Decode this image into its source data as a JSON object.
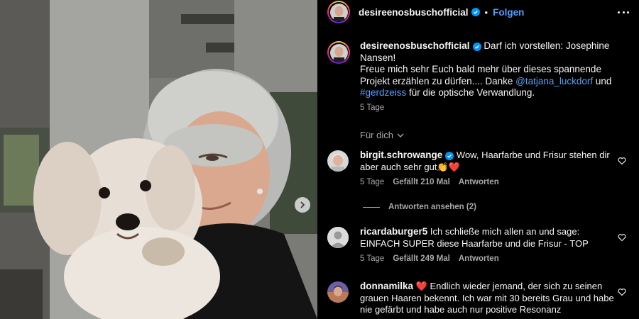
{
  "post": {
    "username": "desireenosbuschofficial",
    "follow_label": "Folgen",
    "separator": "•",
    "more_icon": "more-horizontal-icon",
    "next_icon": "chevron-right-icon"
  },
  "caption": {
    "username": "desireenosbuschofficial",
    "text_1": "Darf ich vorstellen: Josephine Nansen!",
    "text_2": "Freue mich sehr Euch bald mehr über dieses spannende Projekt erzählen zu dürfen.... Danke ",
    "mention": "@tatjana_luckdorf",
    "text_3": " und ",
    "hashtag": "#gerdzeiss",
    "text_4": " für die optische Verwandlung.",
    "time": "5 Tage"
  },
  "for_you": {
    "label": "Für dich"
  },
  "comments": [
    {
      "username": "birgit.schrowange",
      "verified": true,
      "text": "Wow, Haarfarbe und Frisur stehen dir aber auch sehr gut",
      "emoji": "👏❤️",
      "time": "5 Tage",
      "likes": "Gefällt 210 Mal",
      "reply": "Antworten"
    },
    {
      "username": "ricardaburger5",
      "verified": false,
      "text": "Ich schließe mich allen an und sage: EINFACH SUPER diese Haarfarbe und die Frisur - TOP",
      "time": "5 Tage",
      "likes": "Gefällt 249 Mal",
      "reply": "Antworten"
    },
    {
      "username": "donnamilka",
      "verified": false,
      "text": "❤️ Endlich wieder jemand, der sich zu seinen grauen Haaren bekennt. Ich war mit 30 bereits Grau und habe nie gefärbt und habe auch nur positive Resonanz"
    }
  ],
  "replies": {
    "label": "Antworten ansehen (2)"
  },
  "colors": {
    "link": "#4da0ff",
    "verified": "#0095f6",
    "muted": "#a8a8a8",
    "background": "#000000"
  }
}
